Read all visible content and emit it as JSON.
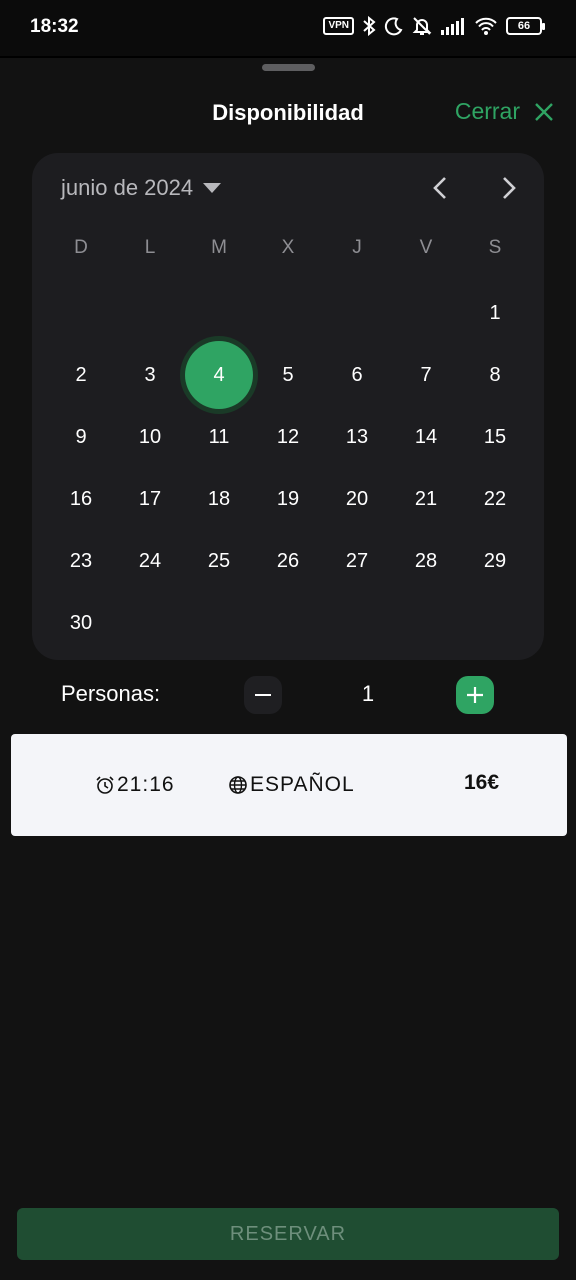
{
  "status_bar": {
    "time": "18:32",
    "vpn_label": "VPN",
    "battery_level": "66",
    "icons": [
      "vpn-icon",
      "bluetooth-icon",
      "moon-icon",
      "bell-off-icon",
      "signal-icon",
      "wifi-icon",
      "battery-icon"
    ]
  },
  "header": {
    "title": "Disponibilidad",
    "close_label": "Cerrar"
  },
  "calendar": {
    "month_label": "junio de 2024",
    "weekdays": [
      "D",
      "L",
      "M",
      "X",
      "J",
      "V",
      "S"
    ],
    "days": [
      "1",
      "2",
      "3",
      "4",
      "5",
      "6",
      "7",
      "8",
      "9",
      "10",
      "11",
      "12",
      "13",
      "14",
      "15",
      "16",
      "17",
      "18",
      "19",
      "20",
      "21",
      "22",
      "23",
      "24",
      "25",
      "26",
      "27",
      "28",
      "29",
      "30"
    ],
    "selected_day": "4"
  },
  "persons": {
    "label": "Personas:",
    "count": "1"
  },
  "slot": {
    "time": "21:16",
    "language": "ESPAÑOL",
    "price": "16€"
  },
  "footer": {
    "reserve_label": "RESERVAR"
  },
  "colors": {
    "accent": "#2fa463",
    "sheet_bg": "#121212",
    "calendar_bg": "#1d1d20",
    "reserve_disabled": "#1f4d32"
  }
}
